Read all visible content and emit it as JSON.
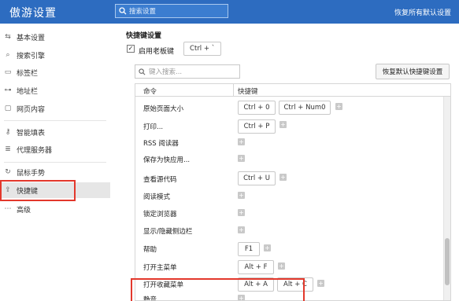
{
  "header": {
    "title": "傲游设置",
    "search_placeholder": "搜索设置",
    "restore_all": "恢复所有默认设置"
  },
  "sidebar": {
    "items": [
      {
        "label": "基本设置",
        "icon": "sliders-icon"
      },
      {
        "label": "搜索引擎",
        "icon": "search-icon"
      },
      {
        "label": "标签栏",
        "icon": "tab-icon"
      },
      {
        "label": "地址栏",
        "icon": "link-icon"
      },
      {
        "label": "网页内容",
        "icon": "page-icon"
      },
      {
        "label": "智能填表",
        "icon": "key-icon"
      },
      {
        "label": "代理服务器",
        "icon": "server-icon"
      },
      {
        "label": "鼠标手势",
        "icon": "gesture-icon"
      },
      {
        "label": "快捷键",
        "icon": "share-icon"
      },
      {
        "label": "高级",
        "icon": "more-icon"
      }
    ],
    "active": "快捷键"
  },
  "shortcuts": {
    "section_title": "快捷键设置",
    "enable_boss_key": {
      "label": "启用老板键",
      "checked": true,
      "key": "Ctrl + `"
    },
    "filter_placeholder": "键入搜索...",
    "reset_button": "恢复默认快捷键设置",
    "columns": {
      "command": "命令",
      "shortcut": "快捷键"
    },
    "rows": [
      {
        "command": "原始页面大小",
        "keys": [
          "Ctrl + 0",
          "Ctrl + Num0"
        ]
      },
      {
        "command": "打印...",
        "keys": [
          "Ctrl + P"
        ]
      },
      {
        "command": "RSS 阅读器",
        "keys": []
      },
      {
        "command": "保存为快应用...",
        "keys": []
      },
      {
        "command": "查看源代码",
        "keys": [
          "Ctrl + U"
        ]
      },
      {
        "command": "阅读模式",
        "keys": []
      },
      {
        "command": "锁定浏览器",
        "keys": []
      },
      {
        "command": "显示/隐藏侧边栏",
        "keys": []
      },
      {
        "command": "帮助",
        "keys": [
          "F1"
        ]
      },
      {
        "command": "打开主菜单",
        "keys": [
          "Alt + F"
        ]
      },
      {
        "command": "打开收藏菜单",
        "keys": [
          "Alt + A",
          "Alt + C"
        ]
      },
      {
        "command": "静音",
        "keys": []
      }
    ],
    "add_symbol": "+"
  },
  "colors": {
    "header_bg": "#2d6cc0",
    "highlight": "#e3382c"
  }
}
